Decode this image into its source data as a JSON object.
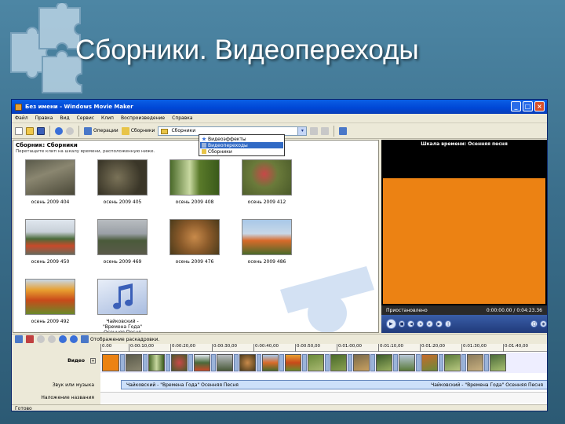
{
  "slide": {
    "title": "Сборники. Видеопереходы"
  },
  "window": {
    "title": "Без имени - Windows Movie Maker",
    "controls": {
      "minimize": "_",
      "maximize": "□",
      "close": "×"
    }
  },
  "menu": [
    "Файл",
    "Правка",
    "Вид",
    "Сервис",
    "Клип",
    "Воспроизведение",
    "Справка"
  ],
  "toolbar": {
    "operations_label": "Операции",
    "collections_label": "Сборники",
    "combo_value": "Сборники",
    "dropdown_items": [
      {
        "label": "Видеоэффекты",
        "icon": "star-icon",
        "selected": false
      },
      {
        "label": "Видеопереходы",
        "icon": "transition-icon",
        "selected": true
      },
      {
        "label": "Сборники",
        "icon": "folder-icon",
        "selected": false
      }
    ]
  },
  "collection": {
    "heading": "Сборник: Сборники",
    "subheading": "Перетащите клип на шкалу времени, расположенную ниже.",
    "items": [
      {
        "caption": "осень 2009 404"
      },
      {
        "caption": "осень 2009 405"
      },
      {
        "caption": "осень 2009 408"
      },
      {
        "caption": "осень 2009 412"
      },
      {
        "caption": "осень 2009 450"
      },
      {
        "caption": "осень 2009 469"
      },
      {
        "caption": "осень 2009 476"
      },
      {
        "caption": "осень 2009 486"
      },
      {
        "caption": "осень 2009 492"
      },
      {
        "caption": "Чайковский - \"Времена Года\" Осенняя Песня"
      }
    ]
  },
  "preview": {
    "title": "Шкала времени: Осенняя песня",
    "status": "Приостановлено",
    "time": "0:00:00.00 / 0:04:23.36",
    "video_color": "#ec8213"
  },
  "timeline": {
    "toolbar_label": "Отображение раскадровки.",
    "ticks": [
      "0.00",
      "0:00:10,00",
      "0:00:20,00",
      "0:00:30,00",
      "0:00:40,00",
      "0:00:50,00",
      "0:01:00,00",
      "0:01:10,00",
      "0:01:20,00",
      "0:01:30,00",
      "0:01:40,00"
    ],
    "video_label": "Видео",
    "audio_label": "Звук или музыка",
    "title_label": "Наложение названия",
    "audio_clip_1": "Чайковский - \"Времена Года\" Осенняя Песня",
    "audio_clip_2": "Чайковский - \"Времена Года\" Осенняя Песня"
  },
  "statusbar": {
    "text": "Готово"
  }
}
